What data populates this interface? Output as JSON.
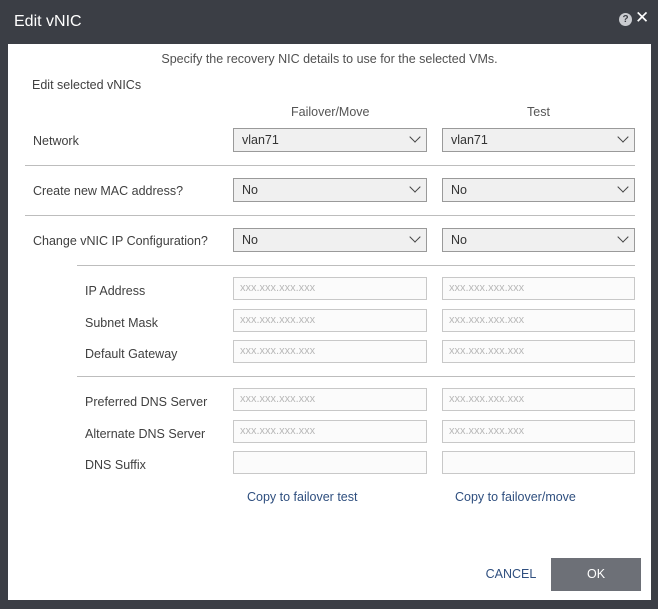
{
  "dialog": {
    "title": "Edit vNIC"
  },
  "instruction": "Specify the recovery NIC details to use for the selected VMs.",
  "section_label": "Edit selected vNICs",
  "columns": {
    "failover": "Failover/Move",
    "test": "Test"
  },
  "network": {
    "label": "Network",
    "failover_value": "vlan71",
    "test_value": "vlan71"
  },
  "mac": {
    "label": "Create new MAC address?",
    "failover_value": "No",
    "test_value": "No"
  },
  "ipconfig": {
    "label": "Change vNIC IP Configuration?",
    "failover_value": "No",
    "test_value": "No"
  },
  "fields": {
    "ip_address": {
      "label": "IP Address",
      "placeholder": "xxx.xxx.xxx.xxx"
    },
    "subnet_mask": {
      "label": "Subnet Mask",
      "placeholder": "xxx.xxx.xxx.xxx"
    },
    "default_gateway": {
      "label": "Default Gateway",
      "placeholder": "xxx.xxx.xxx.xxx"
    },
    "preferred_dns": {
      "label": "Preferred DNS Server",
      "placeholder": "xxx.xxx.xxx.xxx"
    },
    "alternate_dns": {
      "label": "Alternate DNS Server",
      "placeholder": "xxx.xxx.xxx.xxx"
    },
    "dns_suffix": {
      "label": "DNS Suffix",
      "placeholder": ""
    }
  },
  "links": {
    "copy_to_test": "Copy to failover test",
    "copy_to_failover": "Copy to failover/move"
  },
  "buttons": {
    "cancel": "CANCEL",
    "ok": "OK"
  }
}
